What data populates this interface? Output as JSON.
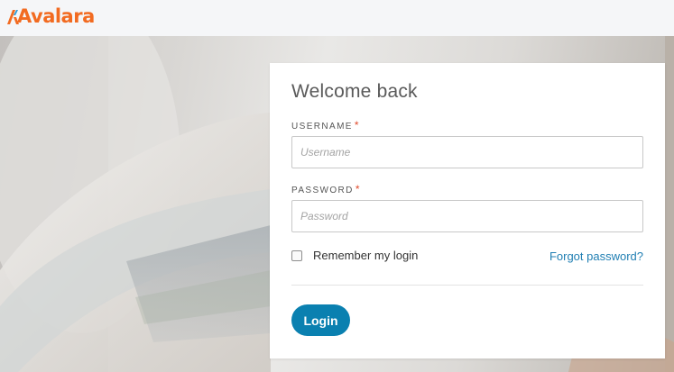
{
  "brand": {
    "logo_text": "Avalara",
    "logo_icon": "avalara-chevron-icon",
    "color": "#f26b21"
  },
  "login": {
    "title": "Welcome back",
    "username": {
      "label": "USERNAME",
      "required_mark": "*",
      "placeholder": "Username",
      "value": ""
    },
    "password": {
      "label": "PASSWORD",
      "required_mark": "*",
      "placeholder": "Password",
      "value": ""
    },
    "remember_label": "Remember my login",
    "remember_checked": false,
    "forgot_label": "Forgot password?",
    "submit_label": "Login"
  },
  "colors": {
    "accent": "#0a80b0",
    "link": "#217fb3",
    "required": "#e04b2c"
  }
}
